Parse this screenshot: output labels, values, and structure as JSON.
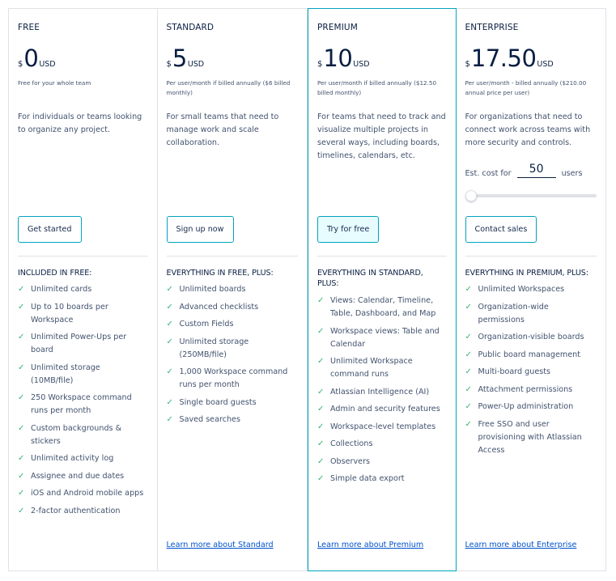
{
  "colors": {
    "accent": "#00a3bf",
    "check": "#36b37e",
    "link": "#0052cc",
    "heading": "#091e42",
    "body": "#42526e",
    "border": "#dfe1e6",
    "primary_button_bg": "#e6fcff"
  },
  "plans": [
    {
      "name": "FREE",
      "currency_symbol": "$",
      "amount": "0",
      "currency": "USD",
      "price_note": "Free for your whole team",
      "description": "For individuals or teams looking to organize any project.",
      "cta_label": "Get started",
      "features_heading": "INCLUDED IN FREE:",
      "features": [
        "Unlimited cards",
        "Up to 10 boards per Workspace",
        "Unlimited Power-Ups per board",
        "Unlimited storage (10MB/file)",
        "250 Workspace command runs per month",
        "Custom backgrounds & stickers",
        "Unlimited activity log",
        "Assignee and due dates",
        "iOS and Android mobile apps",
        "2-factor authentication"
      ],
      "learn_more": null
    },
    {
      "name": "STANDARD",
      "currency_symbol": "$",
      "amount": "5",
      "currency": "USD",
      "price_note": "Per user/month if billed annually ($6 billed monthly)",
      "description": "For small teams that need to manage work and scale collaboration.",
      "cta_label": "Sign up now",
      "features_heading": "EVERYTHING IN FREE, PLUS:",
      "features": [
        "Unlimited boards",
        "Advanced checklists",
        "Custom Fields",
        "Unlimited storage (250MB/file)",
        "1,000 Workspace command runs per month",
        "Single board guests",
        "Saved searches"
      ],
      "learn_more": "Learn more about Standard"
    },
    {
      "name": "PREMIUM",
      "currency_symbol": "$",
      "amount": "10",
      "currency": "USD",
      "price_note": "Per user/month if billed annually ($12.50 billed monthly)",
      "description": "For teams that need to track and visualize multiple projects in several ways, including boards, timelines, calendars, etc.",
      "cta_label": "Try for free",
      "features_heading": "EVERYTHING IN STANDARD, PLUS:",
      "features": [
        "Views: Calendar, Timeline, Table, Dashboard, and Map",
        "Workspace views: Table and Calendar",
        "Unlimited Workspace command runs",
        "Atlassian Intelligence (AI)",
        "Admin and security features",
        "Workspace-level templates",
        "Collections",
        "Observers",
        "Simple data export"
      ],
      "learn_more": "Learn more about Premium"
    },
    {
      "name": "ENTERPRISE",
      "currency_symbol": "$",
      "amount": "17.50",
      "currency": "USD",
      "price_note": "Per user/month - billed annually ($210.00 annual price per user)",
      "description": "For organizations that need to connect work across teams with more security and controls.",
      "estimator": {
        "prefix": "Est. cost for",
        "users_value": "50",
        "suffix": "users",
        "slider_fraction": 0.0
      },
      "cta_label": "Contact sales",
      "features_heading": "EVERYTHING IN PREMIUM, PLUS:",
      "features": [
        "Unlimited Workspaces",
        "Organization-wide permissions",
        "Organization-visible boards",
        "Public board management",
        "Multi-board guests",
        "Attachment permissions",
        "Power-Up administration",
        "Free SSO and user provisioning with Atlassian Access"
      ],
      "learn_more": "Learn more about Enterprise"
    }
  ],
  "icons": {
    "check": "✓"
  }
}
